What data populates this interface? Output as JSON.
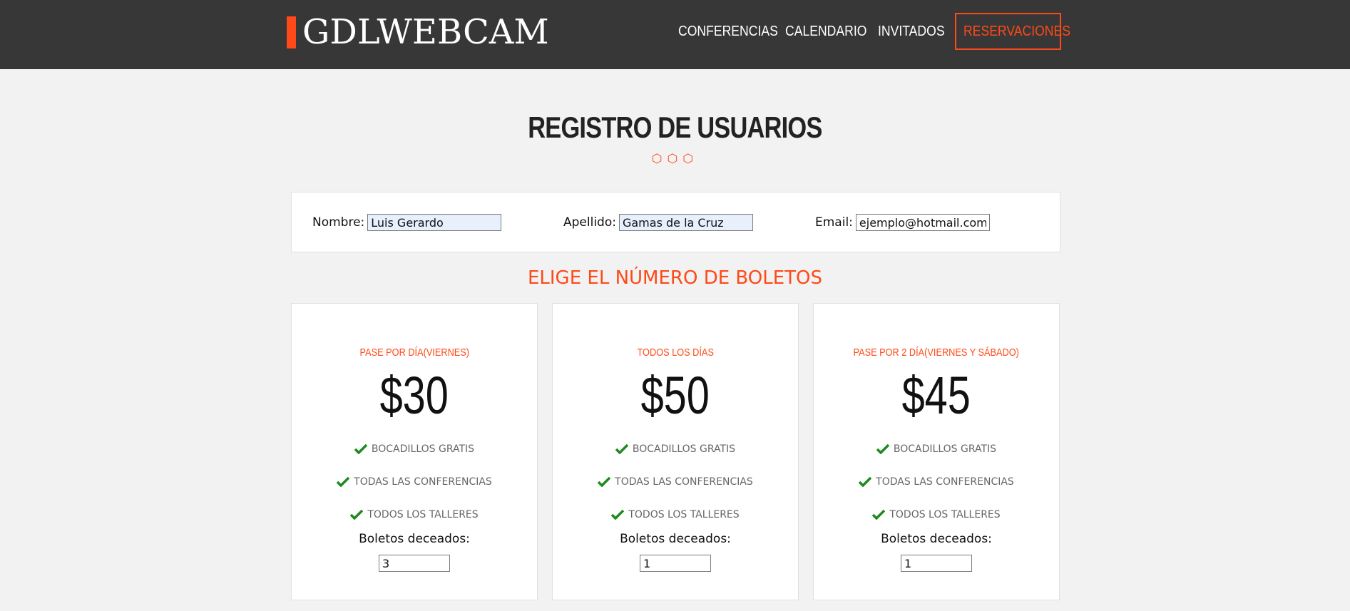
{
  "header": {
    "logo": "GDLWEBCAM",
    "nav": [
      "CONFERENCIAS",
      "CALENDARIO",
      "INVITADOS",
      "RESERVACIONES"
    ],
    "active": "RESERVACIONES",
    "accent_color": "#fe4918",
    "bg_color": "#373737"
  },
  "page": {
    "title": "REGISTRO DE USUARIOS",
    "decor": "⬡⬡⬡"
  },
  "form": {
    "nombre_label": "Nombre:",
    "nombre_value": "Luis Gerardo",
    "apellido_label": "Apellido:",
    "apellido_value": "Gamas de la Cruz",
    "email_label": "Email:",
    "email_value": "ejemplo@hotmail.com"
  },
  "tickets": {
    "heading": "ELIGE EL NÚMERO DE BOLETOS",
    "cards": [
      {
        "label": "PASE POR DÍA(VIERNES)",
        "price": "$30",
        "features": [
          "BOCADILLOS GRATIS",
          "TODAS LAS CONFERENCIAS",
          "TODOS LOS TALLERES"
        ],
        "qty_label": "Boletos deceados:",
        "qty": "3"
      },
      {
        "label": "TODOS LOS DÍAS",
        "price": "$50",
        "features": [
          "BOCADILLOS GRATIS",
          "TODAS LAS CONFERENCIAS",
          "TODOS LOS TALLERES"
        ],
        "qty_label": "Boletos deceados:",
        "qty": "1"
      },
      {
        "label": "PASE POR 2 DÍA(VIERNES Y SÁBADO)",
        "price": "$45",
        "features": [
          "BOCADILLOS GRATIS",
          "TODAS LAS CONFERENCIAS",
          "TODOS LOS TALLERES"
        ],
        "qty_label": "Boletos deceados:",
        "qty": "1"
      }
    ],
    "check_icon": "check-icon",
    "check_color": "#1e8a1e"
  }
}
